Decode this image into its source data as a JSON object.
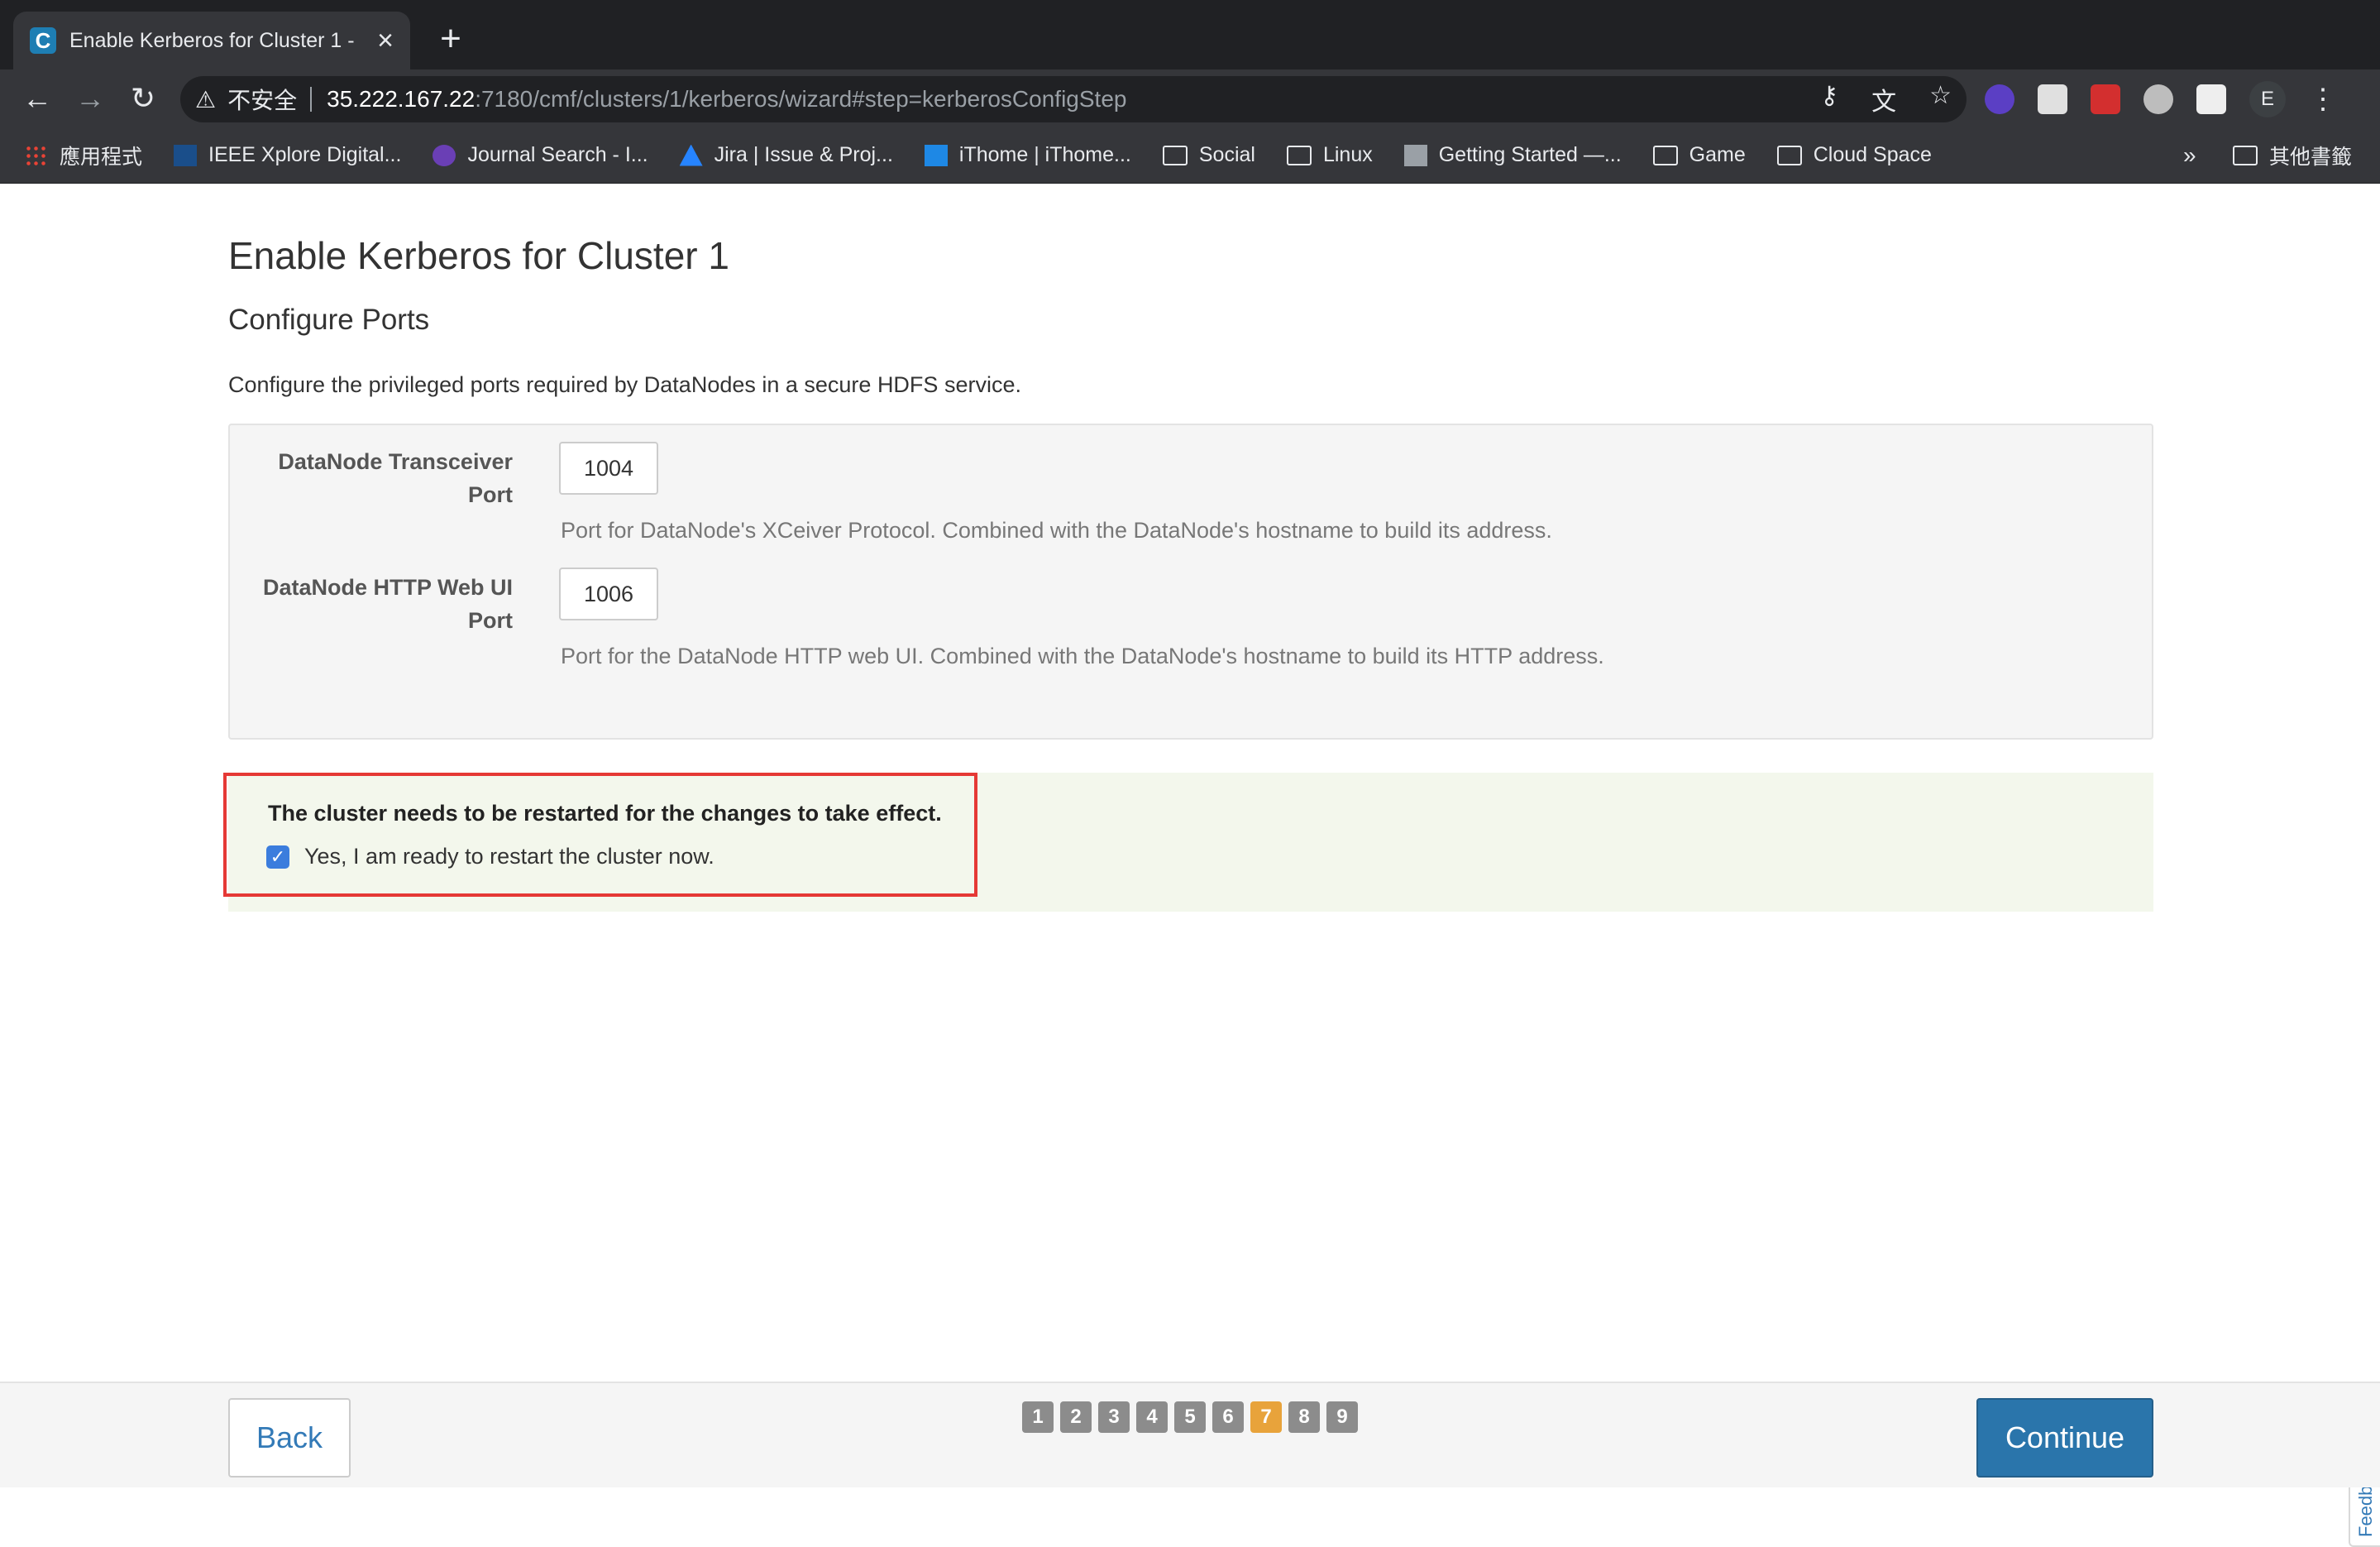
{
  "browser": {
    "tab_title": "Enable Kerberos for Cluster 1 -",
    "favicon_letter": "C",
    "address": {
      "security_label": "不安全",
      "host": "35.222.167.22",
      "rest": ":7180/cmf/clusters/1/kerberos/wizard#step=kerberosConfigStep"
    },
    "profile_initial": "E",
    "bookmarks": [
      {
        "label": "應用程式",
        "icon": "apps-grid-icon"
      },
      {
        "label": "IEEE Xplore Digital...",
        "icon": "ieee-icon"
      },
      {
        "label": "Journal Search - I...",
        "icon": "journal-icon"
      },
      {
        "label": "Jira | Issue & Proj...",
        "icon": "jira-icon"
      },
      {
        "label": "iThome | iThome...",
        "icon": "ithome-icon"
      },
      {
        "label": "Social",
        "icon": "folder-icon"
      },
      {
        "label": "Linux",
        "icon": "folder-icon"
      },
      {
        "label": "Getting Started —...",
        "icon": "getting-started-icon"
      },
      {
        "label": "Game",
        "icon": "folder-icon"
      },
      {
        "label": "Cloud Space",
        "icon": "folder-icon"
      }
    ],
    "bookmarks_more": "»",
    "other_bookmarks": "其他書籤"
  },
  "page": {
    "title": "Enable Kerberos for Cluster 1",
    "subtitle": "Configure Ports",
    "description": "Configure the privileged ports required by DataNodes in a secure HDFS service.",
    "fields": [
      {
        "label_line1": "DataNode Transceiver",
        "label_line2": "Port",
        "value": "1004",
        "help": "Port for DataNode's XCeiver Protocol. Combined with the DataNode's hostname to build its address."
      },
      {
        "label_line1": "DataNode HTTP Web UI",
        "label_line2": "Port",
        "value": "1006",
        "help": "Port for the DataNode HTTP web UI. Combined with the DataNode's hostname to build its HTTP address."
      }
    ],
    "restart_notice": {
      "title": "The cluster needs to be restarted for the changes to take effect.",
      "checkbox_label": "Yes, I am ready to restart the cluster now.",
      "checked": true
    },
    "feedback_label": "Feedback"
  },
  "footer": {
    "back_label": "Back",
    "continue_label": "Continue",
    "steps": [
      "1",
      "2",
      "3",
      "4",
      "5",
      "6",
      "7",
      "8",
      "9"
    ],
    "current_step": "7"
  },
  "colors": {
    "accent": "#2a75ab",
    "active_step": "#e8a33b",
    "notice_bg": "#f3f7ec",
    "highlight_border": "#e53935"
  }
}
